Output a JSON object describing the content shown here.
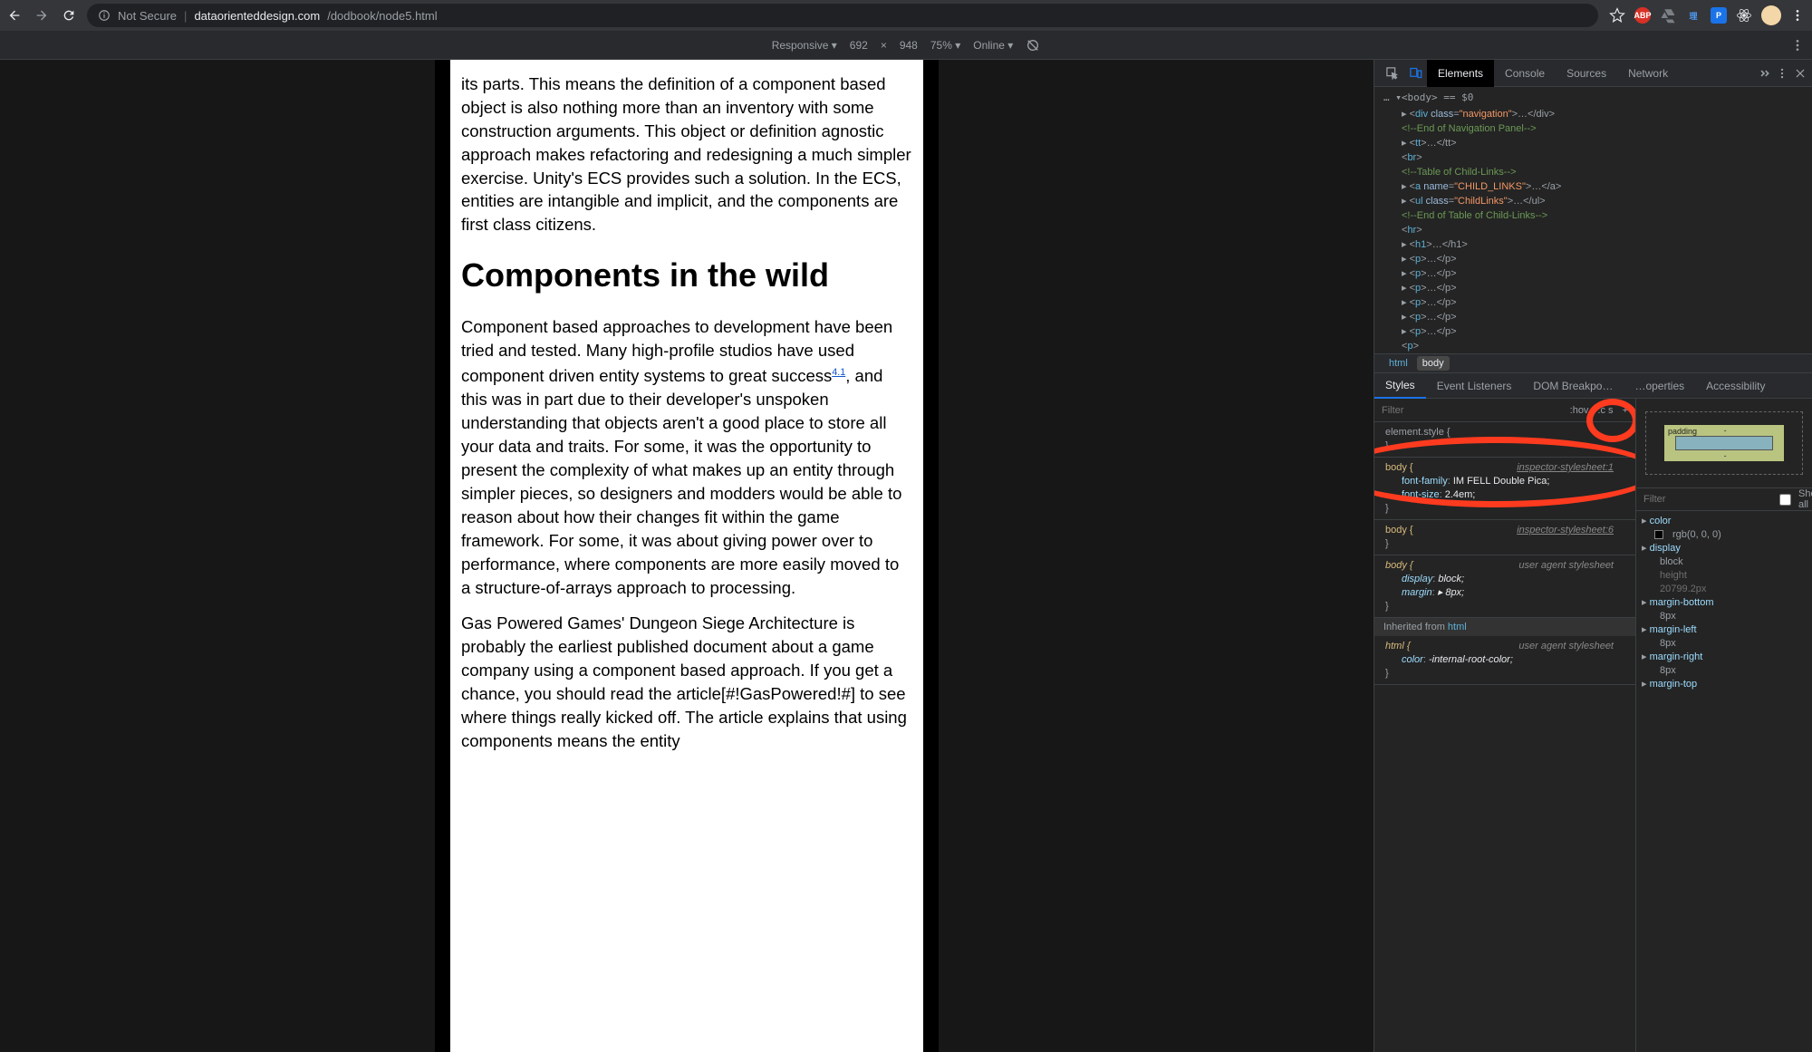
{
  "browser": {
    "not_secure": "Not Secure",
    "url_host": "dataorienteddesign.com",
    "url_path": "/dodbook/node5.html"
  },
  "device_toolbar": {
    "device": "Responsive ▾",
    "width": "692",
    "x": "×",
    "height": "948",
    "zoom": "75% ▾",
    "online": "Online ▾"
  },
  "page": {
    "p1": "its parts. This means the definition of a component based object is also nothing more than an inventory with some construction arguments. This object or definition agnostic approach makes refactoring and redesigning a much simpler exercise. Unity's ECS provides such a solution. In the ECS, entities are intangible and implicit, and the components are first class citizens.",
    "h2": "Components in the wild",
    "p2a": "Component based approaches to development have been tried and tested. Many high-profile studios have used component driven entity systems to great success",
    "p2sup": "4.1",
    "p2b": ", and this was in part due to their developer's unspoken understanding that objects aren't a good place to store all your data and traits. For some, it was the opportunity to present the complexity of what makes up an entity through simpler pieces, so designers and modders would be able to reason about how their changes fit within the game framework. For some, it was about giving power over to performance, where components are more easily moved to a structure-of-arrays approach to processing.",
    "p3": "Gas Powered Games' Dungeon Siege Architecture is probably the earliest published document about a game company using a component based approach. If you get a chance, you should read the article[#!GasPowered!#] to see where things really kicked off. The article explains that using components means the entity"
  },
  "devtools": {
    "tabs": [
      "Elements",
      "Console",
      "Sources",
      "Network"
    ],
    "dom_crumb": "… ▾<body> == $0",
    "dom": {
      "l1": {
        "pre": "▸ <",
        "tag": "div",
        "an": " class",
        "av": "\"navigation\"",
        "post": ">…</div>"
      },
      "l2": "<!--End of Navigation Panel-->",
      "l3": {
        "pre": "▸ <",
        "tag": "tt",
        "post": ">…</tt>"
      },
      "l4": "<br>",
      "l5": "<!--Table of Child-Links-->",
      "l6": {
        "pre": "▸ <",
        "tag": "a",
        "an": " name",
        "av": "\"CHILD_LINKS\"",
        "post": ">…</a>"
      },
      "l7": {
        "pre": "▸ <",
        "tag": "ul",
        "an": " class",
        "av": "\"ChildLinks\"",
        "post": ">…</ul>"
      },
      "l8": "<!--End of Table of Child-Links-->",
      "l9": "<hr>",
      "l10": {
        "pre": "▸ <",
        "tag": "h1",
        "post": ">…</h1>"
      },
      "lp": {
        "pre": "▸ <",
        "tag": "p",
        "post": ">…</p>"
      },
      "lplast": "<p>"
    },
    "breadcrumb": {
      "html": "html",
      "body": "body"
    },
    "styles_tabs": [
      "Styles",
      "Event Listeners",
      "DOM Breakpo…",
      "…operties",
      "Accessibility"
    ],
    "filter_placeholder": "Filter",
    "hov": ":hov",
    "cls": ".c  s",
    "plus": "+",
    "element_style": "element.style {",
    "rule1": {
      "sel": "body {",
      "src": "inspector-stylesheet:1",
      "p1n": "font-family",
      "p1v": " IM FELL Double Pica;",
      "p2n": "font-size",
      "p2v": " 2.4em;",
      "close": "}"
    },
    "rule2": {
      "sel": "body {",
      "src": "inspector-stylesheet:6",
      "close": "}"
    },
    "rule3": {
      "sel": "body {",
      "src": "user agent stylesheet",
      "p1n": "display",
      "p1v": " block;",
      "p2n": "margin",
      "p2v": " ▸ 8px;",
      "close": "}"
    },
    "inherited": "Inherited from ",
    "inherited_tag": "html",
    "rule4": {
      "sel": "html {",
      "src": "user agent stylesheet",
      "p1n": "color",
      "p1v": " -internal-root-color;",
      "close": "}"
    },
    "box": {
      "padding": "padding",
      "dash": "-"
    },
    "computed_filter": "Filter",
    "show_all": "Show all",
    "computed": [
      {
        "n": "color",
        "v": "rgb(0, 0, 0)",
        "swatch": true,
        "dim": false
      },
      {
        "n": "display",
        "v": "",
        "dim": false
      },
      {
        "n": "",
        "v": "block",
        "indent": true,
        "dim": false
      },
      {
        "n": "",
        "v": "height",
        "dim": true,
        "lbl": true
      },
      {
        "n": "",
        "v": "20799.2px",
        "indent": true,
        "dim": true
      },
      {
        "n": "margin-bottom",
        "v": "",
        "dim": false
      },
      {
        "n": "",
        "v": "8px",
        "indent": true,
        "dim": false
      },
      {
        "n": "margin-left",
        "v": "",
        "dim": false
      },
      {
        "n": "",
        "v": "8px",
        "indent": true,
        "dim": false
      },
      {
        "n": "margin-right",
        "v": "",
        "dim": false
      },
      {
        "n": "",
        "v": "8px",
        "indent": true,
        "dim": false
      },
      {
        "n": "margin-top",
        "v": "",
        "dim": false
      }
    ]
  }
}
